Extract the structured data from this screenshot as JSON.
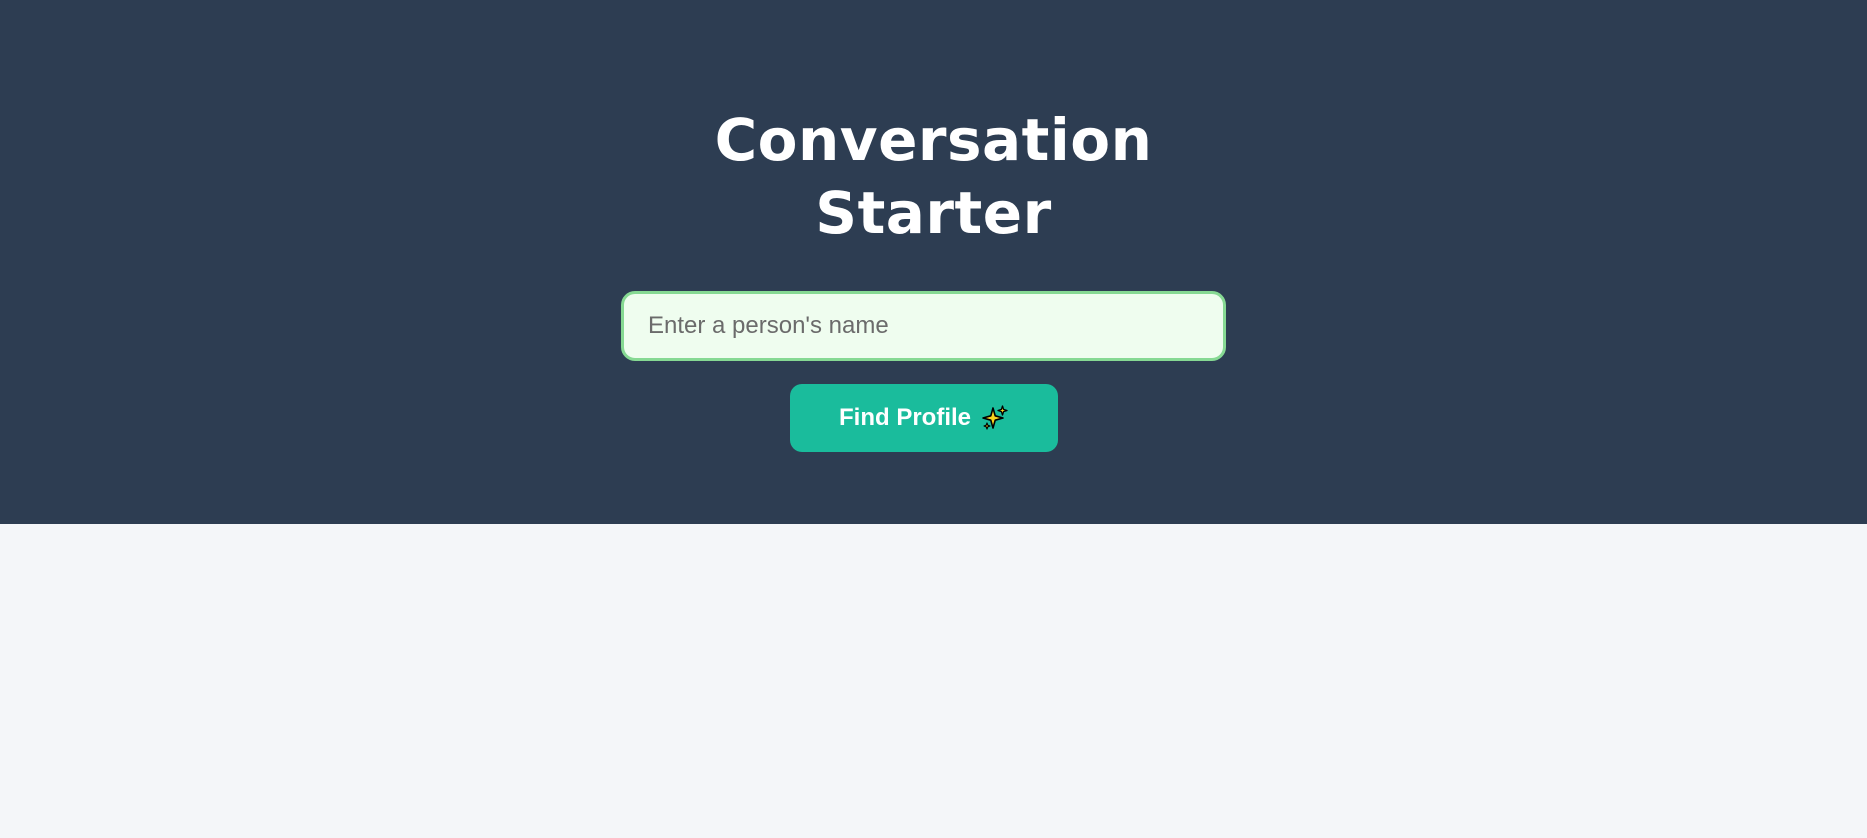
{
  "header": {
    "title_line1": "Conversation",
    "title_line2": "Starter"
  },
  "search": {
    "placeholder": "Enter a person's name",
    "value": ""
  },
  "actions": {
    "find_label": "Find Profile",
    "find_icon": "sparkles-icon"
  },
  "colors": {
    "header_bg": "#2d3d52",
    "page_bg": "#f4f6f9",
    "input_bg": "#effdef",
    "input_border": "#86d993",
    "button_bg": "#1abc9c",
    "sparkle_fill": "#f7d31e"
  }
}
